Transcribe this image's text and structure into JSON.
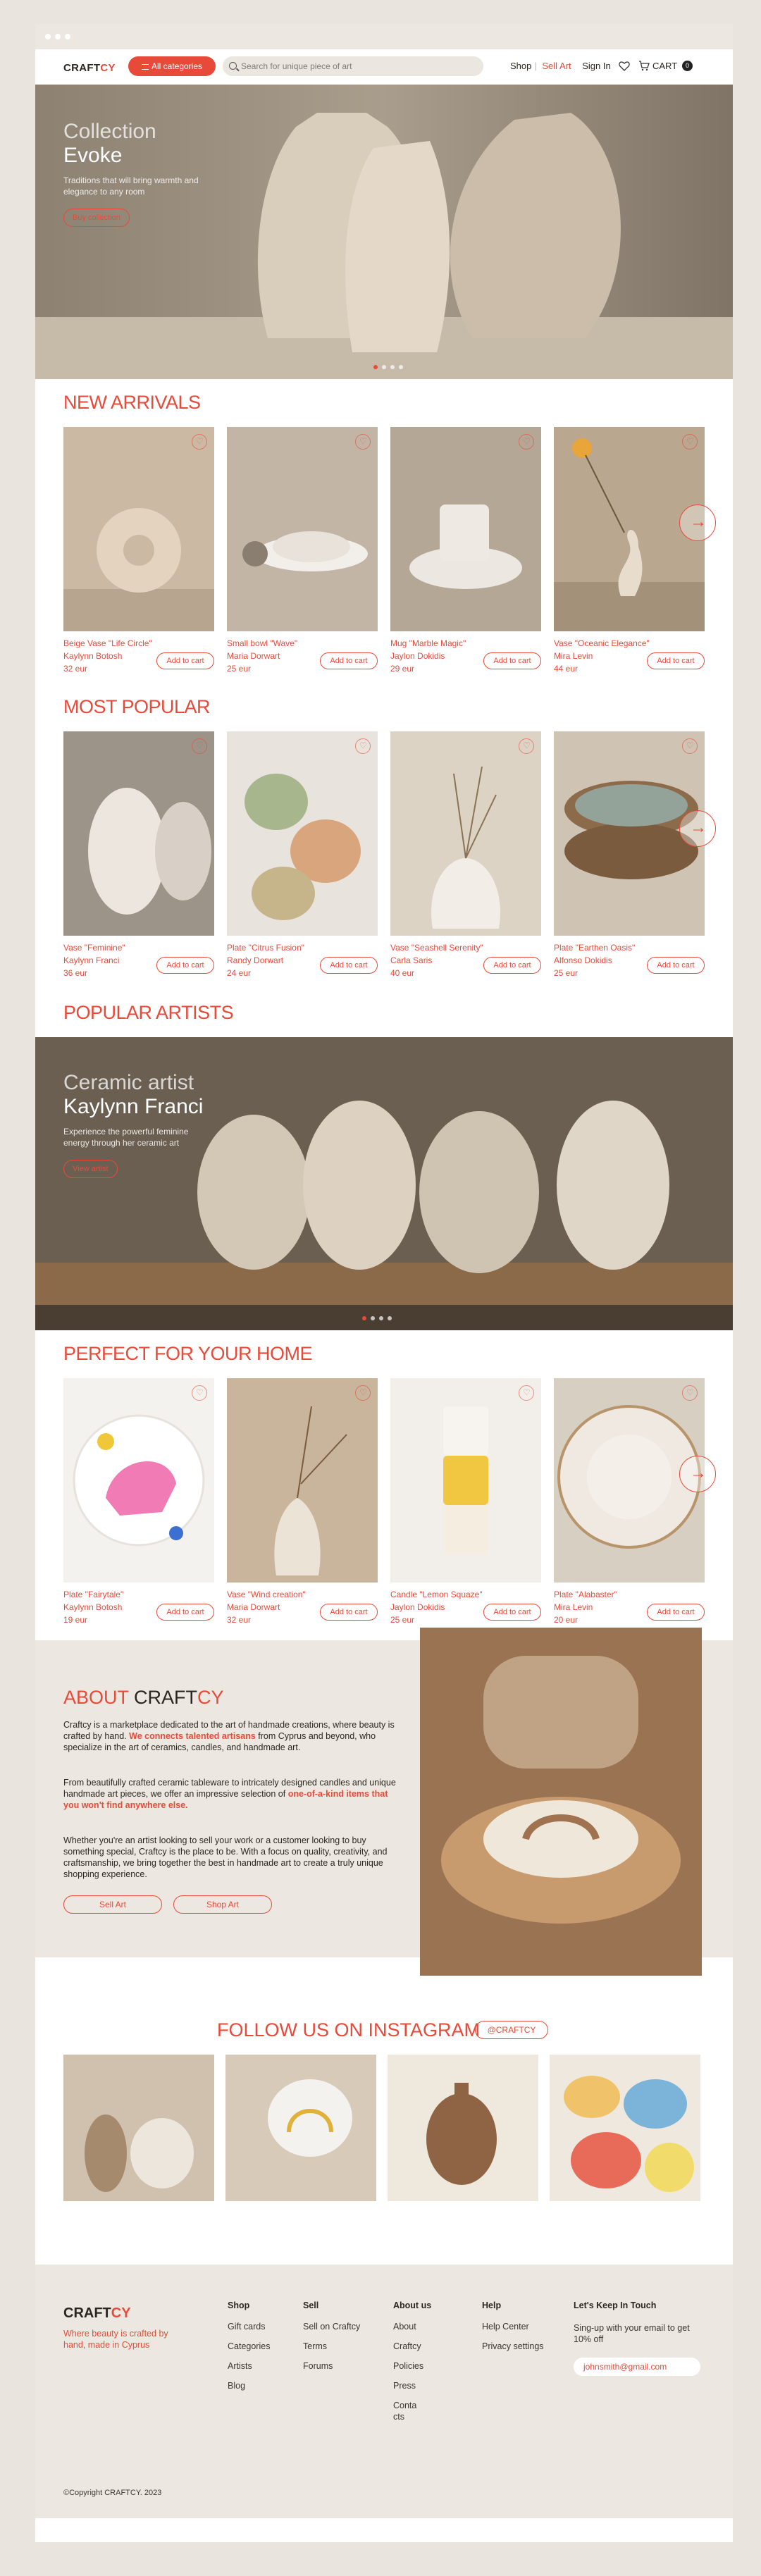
{
  "brand": {
    "name_a": "CRAFT",
    "name_b": "CY"
  },
  "header": {
    "all_categories": "All categories",
    "search_placeholder": "Search for unique piece of art",
    "shop": "Shop",
    "sell_art": "Sell Art",
    "sign_in": "Sign In",
    "cart_label": "CART",
    "cart_count": "0"
  },
  "hero": {
    "subtitle": "Collection",
    "title": "Evoke",
    "description": "Traditions that will bring warmth and elegance to any room",
    "button": "Buy collection"
  },
  "new_arrivals": {
    "title": "NEW ARRIVALS",
    "items": [
      {
        "name": "Beige Vase \"Life Circle\"",
        "artist": "Kaylynn Botosh",
        "price": "32 eur",
        "button": "Add to cart"
      },
      {
        "name": "Small bowl \"Wave\"",
        "artist": "Maria Dorwart",
        "price": "25 eur",
        "button": "Add to cart"
      },
      {
        "name": "Mug \"Marble Magic\"",
        "artist": "Jaylon Dokidis",
        "price": "29 eur",
        "button": "Add to cart"
      },
      {
        "name": "Vase \"Oceanic Elegance\"",
        "artist": "Mira Levin",
        "price": "44 eur",
        "button": "Add to cart"
      }
    ]
  },
  "most_popular": {
    "title": "MOST POPULAR",
    "items": [
      {
        "name": "Vase \"Feminine\"",
        "artist": "Kaylynn Franci",
        "price": "36 eur",
        "button": "Add to cart"
      },
      {
        "name": "Plate \"Citrus Fusion\"",
        "artist": "Randy Dorwart",
        "price": "24 eur",
        "button": "Add to cart"
      },
      {
        "name": "Vase \"Seashell Serenity\"",
        "artist": "Carla Saris",
        "price": "40 eur",
        "button": "Add to cart"
      },
      {
        "name": "Plate \"Earthen Oasis\"",
        "artist": "Alfonso Dokidis",
        "price": "25 eur",
        "button": "Add to cart"
      }
    ]
  },
  "popular_artists": {
    "title": "POPULAR ARTISTS",
    "subtitle": "Ceramic artist",
    "name": "Kaylynn Franci",
    "description": "Experience the powerful feminine energy through her ceramic art",
    "button": "View artist"
  },
  "perfect_home": {
    "title": "PERFECT FOR YOUR HOME",
    "items": [
      {
        "name": "Plate \"Fairytale\"",
        "artist": "Kaylynn Botosh",
        "price": "19 eur",
        "button": "Add to cart"
      },
      {
        "name": "Vase \"Wind creation\"",
        "artist": "Maria Dorwart",
        "price": "32 eur",
        "button": "Add to cart"
      },
      {
        "name": "Candle \"Lemon Squaze\"",
        "artist": "Jaylon Dokidis",
        "price": "25 eur",
        "button": "Add to cart"
      },
      {
        "name": "Plate \"Alabaster\"",
        "artist": "Mira Levin",
        "price": "20 eur",
        "button": "Add to cart"
      }
    ]
  },
  "about": {
    "title_a": "ABOUT ",
    "title_b": "CRAFT",
    "title_c": "CY",
    "p1_a": "Craftcy is a marketplace dedicated to the art of handmade creations, where beauty is crafted by hand. ",
    "p1_b": "We connects talented artisans",
    "p1_c": " from Cyprus and beyond, who specialize in the art of ceramics, candles, and handmade art.",
    "p2_a": "From beautifully crafted ceramic tableware to intricately designed candles and unique handmade art pieces, we offer an impressive selection of ",
    "p2_b": "one-of-a-kind items that you won't find anywhere else.",
    "p3": "Whether you're an artist looking to sell your work or a customer looking to buy something special, Craftcy is the place to be. With a focus on quality, creativity, and craftsmanship, we bring together the best in handmade art to create a truly unique shopping experience.",
    "sell_button": "Sell Art",
    "shop_button": "Shop Art"
  },
  "instagram": {
    "title": "FOLLOW US ON INSTAGRAM",
    "tag": "@CRAFTCY"
  },
  "footer": {
    "tagline": "Where beauty is crafted by hand, made in Cyprus",
    "shop": {
      "heading": "Shop",
      "items": [
        "Gift cards",
        "Categories",
        "Artists",
        "Blog"
      ]
    },
    "sell": {
      "heading": "Sell",
      "items": [
        "Sell on Craftcy",
        "Terms",
        "Forums"
      ]
    },
    "about": {
      "heading": "About us",
      "items": [
        "About Craftcy",
        "Policies",
        "Press",
        "Conta\ncts"
      ]
    },
    "help": {
      "heading": "Help",
      "items": [
        "Help Center",
        "Privacy settings"
      ]
    },
    "touch": {
      "heading": "Let's Keep In Touch",
      "text": "Sing-up with your email to get 10% off",
      "email": "johnsmith@gmail.com"
    },
    "copyright": "©Copyright CRAFTCY. 2023"
  }
}
